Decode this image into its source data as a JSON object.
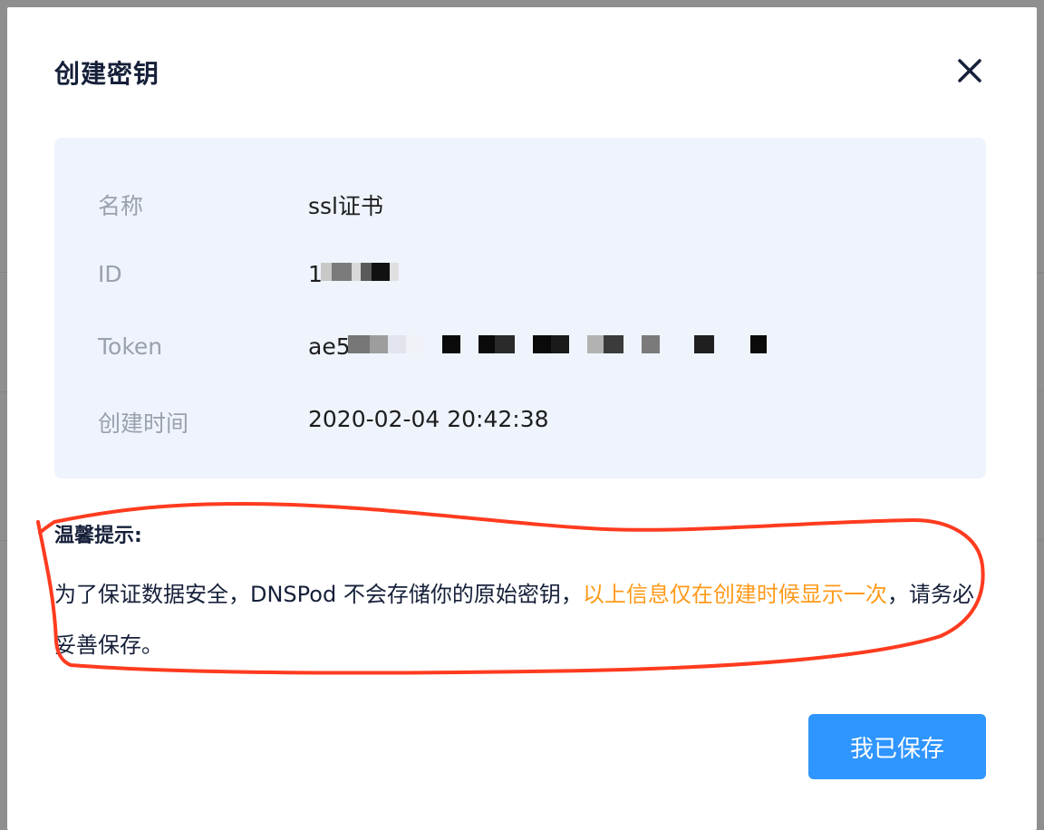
{
  "dialog": {
    "title": "创建密钥",
    "close_icon": "close-icon"
  },
  "info": {
    "rows": [
      {
        "label": "名称",
        "value": "ssl证书"
      },
      {
        "label": "ID",
        "value": "1"
      },
      {
        "label": "Token",
        "value": "ae5"
      },
      {
        "label": "创建时间",
        "value": "2020-02-04 20:42:38"
      }
    ]
  },
  "tip": {
    "title": "温馨提示:",
    "text_before": "为了保证数据安全，DNSPod 不会存储你的原始密钥，",
    "highlight": "以上信息仅在创建时候显示一次",
    "text_after": "，请务必妥善保存。"
  },
  "actions": {
    "save_label": "我已保存"
  },
  "colors": {
    "primary": "#2f95ff",
    "highlight": "#ff9a1a",
    "annotation": "#ff3b1f"
  }
}
